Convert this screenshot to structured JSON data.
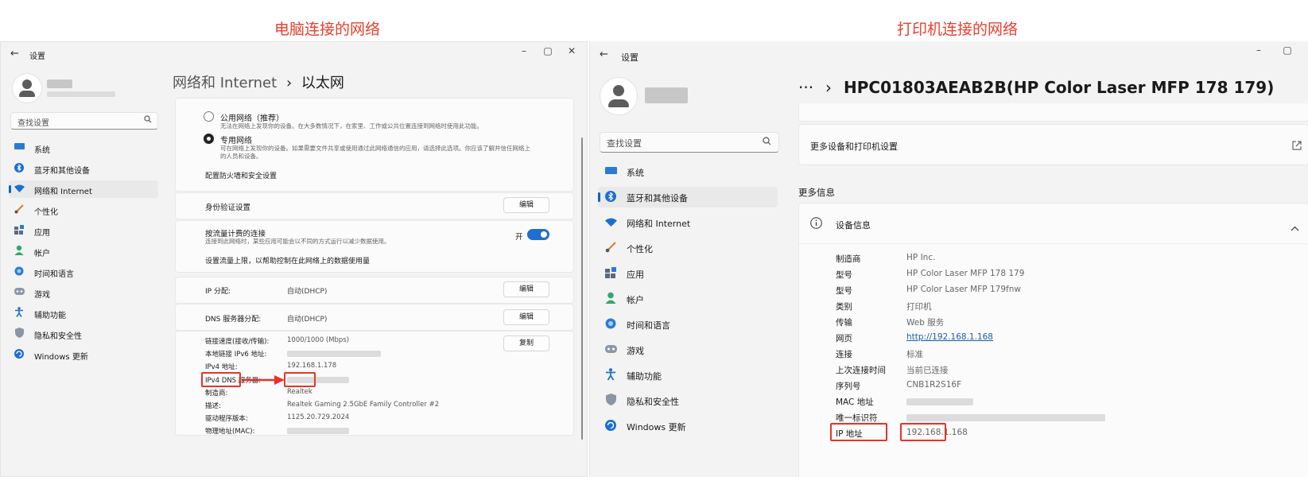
{
  "captions": {
    "left": "电脑连接的网络",
    "right": "打印机连接的网络"
  },
  "colors": {
    "accent": "#0067c0",
    "annotation": "#e8332a",
    "toggle_on": "#1f6fd1"
  },
  "left": {
    "window_title": "设置",
    "back_icon": "←",
    "controls": [
      "–",
      "▢",
      "✕"
    ],
    "search_placeholder": "查找设置",
    "nav": [
      {
        "label": "系统",
        "icon": "monitor-icon"
      },
      {
        "label": "蓝牙和其他设备",
        "icon": "bluetooth-icon"
      },
      {
        "label": "网络和 Internet",
        "icon": "wifi-icon",
        "selected": true
      },
      {
        "label": "个性化",
        "icon": "brush-icon"
      },
      {
        "label": "应用",
        "icon": "apps-icon"
      },
      {
        "label": "帐户",
        "icon": "person-icon"
      },
      {
        "label": "时间和语言",
        "icon": "globe-clock-icon"
      },
      {
        "label": "游戏",
        "icon": "gamepad-icon"
      },
      {
        "label": "辅助功能",
        "icon": "accessibility-icon"
      },
      {
        "label": "隐私和安全性",
        "icon": "shield-icon"
      },
      {
        "label": "Windows 更新",
        "icon": "update-icon"
      }
    ],
    "breadcrumb": {
      "parent": "网络和 Internet",
      "separator": "›",
      "current": "以太网"
    },
    "network_profile": {
      "public_label": "公用网络（推荐）",
      "public_desc": "无法在网络上发现你的设备。在大多数情况下，在家里、工作或公共位置连接到网络时使用此功能。",
      "private_label": "专用网络",
      "private_desc_1": "可在网络上发现你的设备。如果需要文件共享或使用通过此网络通信的应用，请选择此选项。你应该了解并信任网络上",
      "private_desc_2": "的人员和设备。",
      "firewall_link": "配置防火墙和安全设置"
    },
    "auth": {
      "label": "身份验证设置",
      "button": "编辑"
    },
    "metered": {
      "label": "按流量计费的连接",
      "desc": "连接到此网络时，某些应用可能会以不同的方式运行以减少数据使用。",
      "toggle_text": "开",
      "toggle_on": true,
      "data_limit_link": "设置流量上限，以帮助控制在此网络上的数据使用量"
    },
    "ip_assign": {
      "label": "IP 分配:",
      "value": "自动(DHCP)",
      "button": "编辑"
    },
    "dns_assign": {
      "label": "DNS 服务器分配:",
      "value": "自动(DHCP)",
      "button": "编辑"
    },
    "props": {
      "copy_button": "复制",
      "rows": [
        {
          "label": "链接速度(接收/传输):",
          "value": "1000/1000 (Mbps)"
        },
        {
          "label": "本地链接 IPv6 地址:",
          "value": ""
        },
        {
          "label": "IPv4 地址:",
          "value": "192.168.1.178"
        },
        {
          "label": "IPv4 DNS 服务器:",
          "value": ""
        },
        {
          "label": "制造商:",
          "value": "Realtek"
        },
        {
          "label": "描述:",
          "value": "Realtek Gaming 2.5GbE Family Controller #2"
        },
        {
          "label": "驱动程序版本:",
          "value": "1125.20.729.2024"
        },
        {
          "label": "物理地址(MAC):",
          "value": ""
        }
      ]
    }
  },
  "right": {
    "window_title": "设置",
    "back_icon": "←",
    "controls": [
      "–",
      "▢"
    ],
    "search_placeholder": "查找设置",
    "nav": [
      {
        "label": "系统",
        "icon": "monitor-icon"
      },
      {
        "label": "蓝牙和其他设备",
        "icon": "bluetooth-icon",
        "selected": true
      },
      {
        "label": "网络和 Internet",
        "icon": "wifi-icon"
      },
      {
        "label": "个性化",
        "icon": "brush-icon"
      },
      {
        "label": "应用",
        "icon": "apps-icon"
      },
      {
        "label": "帐户",
        "icon": "person-icon"
      },
      {
        "label": "时间和语言",
        "icon": "globe-clock-icon"
      },
      {
        "label": "游戏",
        "icon": "gamepad-icon"
      },
      {
        "label": "辅助功能",
        "icon": "accessibility-icon"
      },
      {
        "label": "隐私和安全性",
        "icon": "shield-icon"
      },
      {
        "label": "Windows 更新",
        "icon": "update-icon"
      }
    ],
    "breadcrumb": {
      "ellipsis": "···",
      "separator": "›",
      "current": "HPC01803AEAB2B(HP Color Laser MFP 178 179)"
    },
    "more_settings": {
      "label": "更多设备和打印机设置",
      "icon": "external-link-icon"
    },
    "more_info_heading": "更多信息",
    "device_info": {
      "header": "设备信息",
      "info_icon": "info-icon",
      "chevron": "chevron-up-icon",
      "rows": [
        {
          "label": "制造商",
          "value": "HP Inc."
        },
        {
          "label": "型号",
          "value": "HP Color Laser MFP 178 179"
        },
        {
          "label": "型号",
          "value": "HP Color Laser MFP 179fnw"
        },
        {
          "label": "类别",
          "value": "打印机"
        },
        {
          "label": "传输",
          "value": "Web 服务"
        },
        {
          "label": "网页",
          "value": "http://192.168.1.168",
          "link": true
        },
        {
          "label": "连接",
          "value": "标准"
        },
        {
          "label": "上次连接时间",
          "value": "当前已连接"
        },
        {
          "label": "序列号",
          "value": "CNB1R2S16F"
        },
        {
          "label": "MAC 地址",
          "value": ""
        },
        {
          "label": "唯一标识符",
          "value": ""
        },
        {
          "label": "IP 地址",
          "value": "192.168.1.168"
        }
      ]
    }
  }
}
